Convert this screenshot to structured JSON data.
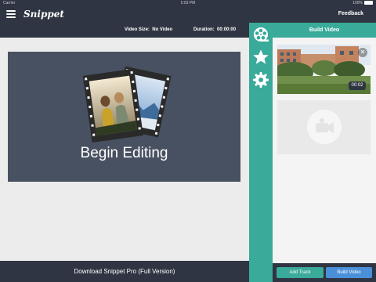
{
  "status_bar": {
    "carrier": "Carrier",
    "time": "5:03 PM",
    "battery": "100%"
  },
  "nav_bar": {
    "app_title": "Snippet",
    "feedback_label": "Feedback"
  },
  "info_bar": {
    "video_size_label": "Video Size:",
    "video_size_value": "No Video",
    "duration_label": "Duration:",
    "duration_value": "00:00:00"
  },
  "editor": {
    "placeholder_text": "Begin Editing"
  },
  "bottom_bar": {
    "download_label": "Download Snippet Pro (Full Version)"
  },
  "sidebar_rail": {
    "items": [
      {
        "icon": "film-reel-icon"
      },
      {
        "icon": "star-icon"
      },
      {
        "icon": "gear-icon"
      }
    ]
  },
  "build_panel": {
    "title": "Build Video",
    "clips": [
      {
        "duration": "00:02",
        "remove_icon": "close-icon"
      }
    ],
    "empty_slot_icon": "camera-icon",
    "add_track_label": "Add Track",
    "build_video_label": "Build Video"
  },
  "colors": {
    "dark": "#2f3542",
    "teal": "#3aaa9a",
    "blue": "#4a90d9",
    "canvas": "#485161"
  }
}
